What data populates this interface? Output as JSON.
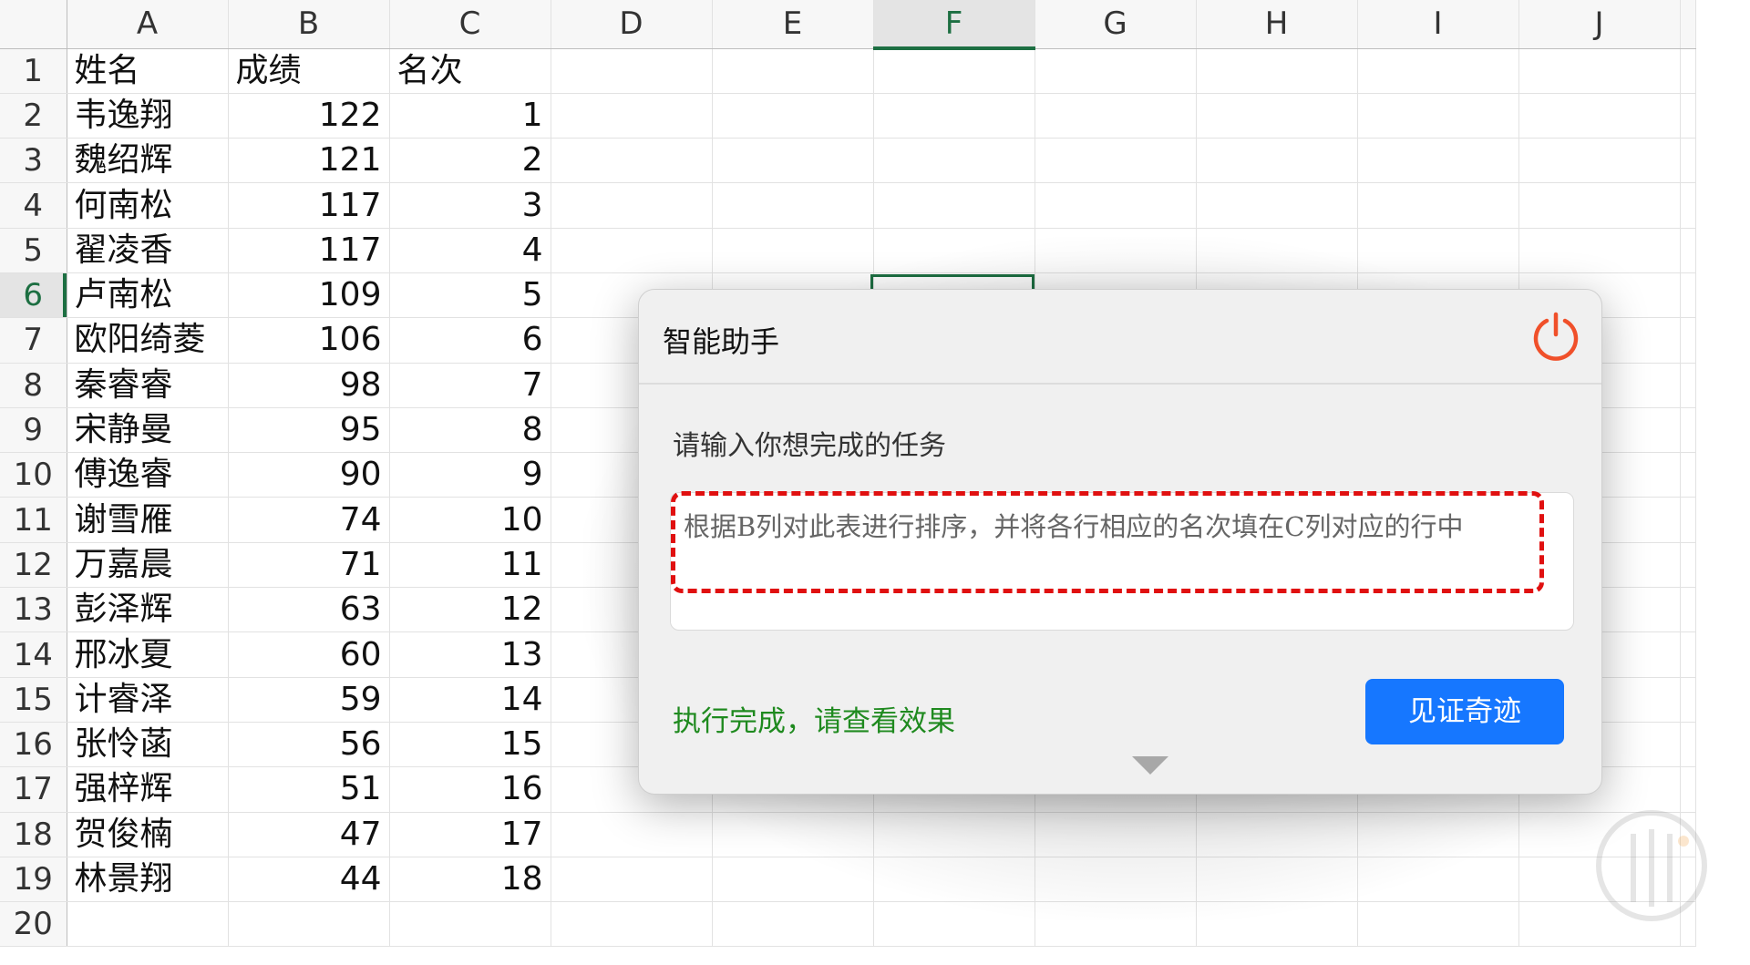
{
  "sheet": {
    "columns": [
      "A",
      "B",
      "C",
      "D",
      "E",
      "F",
      "G",
      "H",
      "I",
      "J"
    ],
    "selected_column": "F",
    "selected_row": 6,
    "rows": [
      {
        "num": "1",
        "a": "姓名",
        "b": "成绩",
        "c": "名次"
      },
      {
        "num": "2",
        "a": "韦逸翔",
        "b": "122",
        "c": "1"
      },
      {
        "num": "3",
        "a": "魏绍辉",
        "b": "121",
        "c": "2"
      },
      {
        "num": "4",
        "a": "何南松",
        "b": "117",
        "c": "3"
      },
      {
        "num": "5",
        "a": "翟凌香",
        "b": "117",
        "c": "4"
      },
      {
        "num": "6",
        "a": "卢南松",
        "b": "109",
        "c": "5"
      },
      {
        "num": "7",
        "a": "欧阳绮菱",
        "b": "106",
        "c": "6"
      },
      {
        "num": "8",
        "a": "秦睿睿",
        "b": "98",
        "c": "7"
      },
      {
        "num": "9",
        "a": "宋静曼",
        "b": "95",
        "c": "8"
      },
      {
        "num": "10",
        "a": "傅逸睿",
        "b": "90",
        "c": "9"
      },
      {
        "num": "11",
        "a": "谢雪雁",
        "b": "74",
        "c": "10"
      },
      {
        "num": "12",
        "a": "万嘉晨",
        "b": "71",
        "c": "11"
      },
      {
        "num": "13",
        "a": "彭泽辉",
        "b": "63",
        "c": "12"
      },
      {
        "num": "14",
        "a": "邢冰夏",
        "b": "60",
        "c": "13"
      },
      {
        "num": "15",
        "a": "计睿泽",
        "b": "59",
        "c": "14"
      },
      {
        "num": "16",
        "a": "张怜菡",
        "b": "56",
        "c": "15"
      },
      {
        "num": "17",
        "a": "强梓辉",
        "b": "51",
        "c": "16"
      },
      {
        "num": "18",
        "a": "贺俊楠",
        "b": "47",
        "c": "17"
      },
      {
        "num": "19",
        "a": "林景翔",
        "b": "44",
        "c": "18"
      },
      {
        "num": "20",
        "a": "",
        "b": "",
        "c": ""
      }
    ]
  },
  "dialog": {
    "title": "智能助手",
    "prompt_label": "请输入你想完成的任务",
    "task_text": "根据B列对此表进行排序，并将各行相应的名次填在C列对应的行中",
    "status_text": "执行完成，请查看效果",
    "run_button": "见证奇迹",
    "accent_color": "#1677ff",
    "status_color": "#1f8a1f",
    "power_icon_color": "#f0502a",
    "highlight_color": "#e01010"
  },
  "icons": {
    "power": "power-icon",
    "collapse": "triangle-down-icon",
    "watermark": "watermark-logo"
  }
}
